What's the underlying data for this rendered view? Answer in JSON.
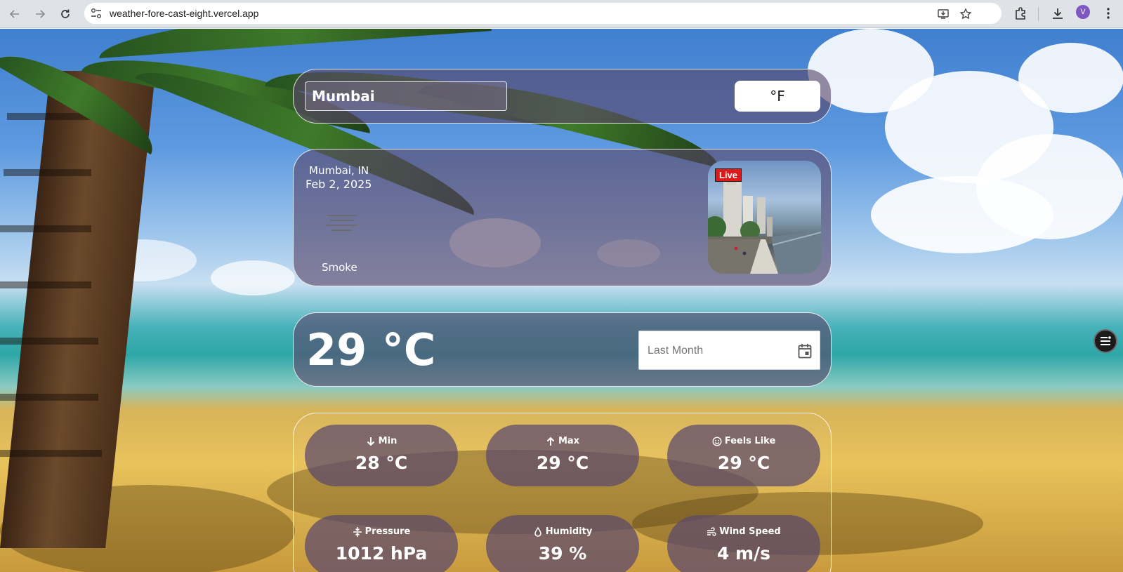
{
  "browser": {
    "url": "weather-fore-cast-eight.vercel.app",
    "profile_initial": "V",
    "profile_color": "#7e57c2",
    "icons": [
      "back-arrow-icon",
      "forward-arrow-icon",
      "reload-icon",
      "site-info-icon",
      "install-app-icon",
      "bookmark-star-icon",
      "extensions-icon",
      "downloads-icon",
      "menu-dots-icon"
    ]
  },
  "search": {
    "value": "Mumbai",
    "unit_toggle_label": "°F"
  },
  "current": {
    "location": "Mumbai, IN",
    "date": "Feb 2, 2025",
    "condition": "Smoke",
    "condition_icon": "smoke-haze-icon",
    "live_label": "Live"
  },
  "temperature": {
    "value": "29 °C",
    "range_placeholder": "Last Month"
  },
  "stats": {
    "min": {
      "label": "Min",
      "value": "28 °C",
      "icon": "arrow-down-icon"
    },
    "max": {
      "label": "Max",
      "value": "29 °C",
      "icon": "arrow-up-icon"
    },
    "feels_like": {
      "label": "Feels Like",
      "value": "29 °C",
      "icon": "smiley-icon"
    },
    "pressure": {
      "label": "Pressure",
      "value": "1012 hPa",
      "icon": "compress-icon"
    },
    "humidity": {
      "label": "Humidity",
      "value": "39 %",
      "icon": "droplet-icon"
    },
    "wind_speed": {
      "label": "Wind Speed",
      "value": "4 m/s",
      "icon": "wind-icon"
    }
  },
  "colors": {
    "card_bg": "#584669",
    "live_badge": "#e01818",
    "text": "#ffffff"
  }
}
